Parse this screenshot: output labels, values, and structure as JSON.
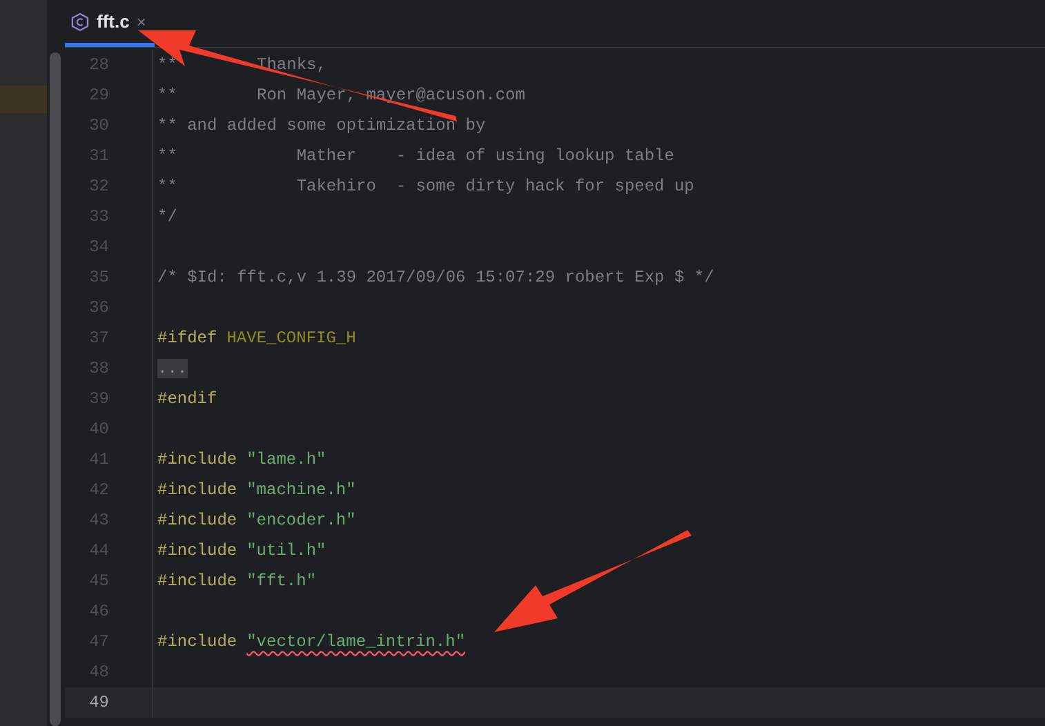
{
  "tab": {
    "label": "fft.c",
    "close": "×",
    "selected": true
  },
  "lines": [
    {
      "number": "28",
      "current": false,
      "tokens": [
        {
          "kind": "comment",
          "text": "**        Thanks,"
        }
      ]
    },
    {
      "number": "29",
      "current": false,
      "tokens": [
        {
          "kind": "comment",
          "text": "**        Ron Mayer, mayer@acuson.com"
        }
      ]
    },
    {
      "number": "30",
      "current": false,
      "tokens": [
        {
          "kind": "comment",
          "text": "** and added some optimization by"
        }
      ]
    },
    {
      "number": "31",
      "current": false,
      "tokens": [
        {
          "kind": "comment",
          "text": "**            Mather    - idea of using lookup table"
        }
      ]
    },
    {
      "number": "32",
      "current": false,
      "tokens": [
        {
          "kind": "comment",
          "text": "**            Takehiro  - some dirty hack for speed up"
        }
      ]
    },
    {
      "number": "33",
      "current": false,
      "tokens": [
        {
          "kind": "comment",
          "text": "*/"
        }
      ]
    },
    {
      "number": "34",
      "current": false
    },
    {
      "number": "35",
      "current": false,
      "tokens": [
        {
          "kind": "comment",
          "text": "/* $Id: fft.c,v 1.39 2017/09/06 15:07:29 robert Exp $ */"
        }
      ]
    },
    {
      "number": "36",
      "current": false
    },
    {
      "number": "37",
      "current": false,
      "tokens": [
        {
          "kind": "directive",
          "text": "#ifdef"
        },
        {
          "kind": "macro",
          "text": "HAVE_CONFIG_H"
        }
      ]
    },
    {
      "number": "38",
      "current": false,
      "tokens": [
        {
          "kind": "fold",
          "text": "..."
        }
      ]
    },
    {
      "number": "39",
      "current": false,
      "tokens": [
        {
          "kind": "directive",
          "text": "#endif"
        }
      ]
    },
    {
      "number": "40",
      "current": false
    },
    {
      "number": "41",
      "current": false,
      "tokens": [
        {
          "kind": "directive",
          "text": "#include"
        },
        {
          "kind": "string",
          "text": "\"lame.h\""
        }
      ]
    },
    {
      "number": "42",
      "current": false,
      "tokens": [
        {
          "kind": "directive",
          "text": "#include"
        },
        {
          "kind": "string",
          "text": "\"machine.h\""
        }
      ]
    },
    {
      "number": "43",
      "current": false,
      "tokens": [
        {
          "kind": "directive",
          "text": "#include"
        },
        {
          "kind": "string",
          "text": "\"encoder.h\""
        }
      ]
    },
    {
      "number": "44",
      "current": false,
      "tokens": [
        {
          "kind": "directive",
          "text": "#include"
        },
        {
          "kind": "string",
          "text": "\"util.h\""
        }
      ]
    },
    {
      "number": "45",
      "current": false,
      "tokens": [
        {
          "kind": "directive",
          "text": "#include"
        },
        {
          "kind": "string",
          "text": "\"fft.h\""
        }
      ]
    },
    {
      "number": "46",
      "current": false
    },
    {
      "number": "47",
      "current": false,
      "tokens": [
        {
          "kind": "directive",
          "text": "#include"
        },
        {
          "kind": "error-string",
          "text": "\"vector/lame_intrin.h\""
        }
      ]
    },
    {
      "number": "48",
      "current": false
    },
    {
      "number": "49",
      "current": true
    }
  ]
}
